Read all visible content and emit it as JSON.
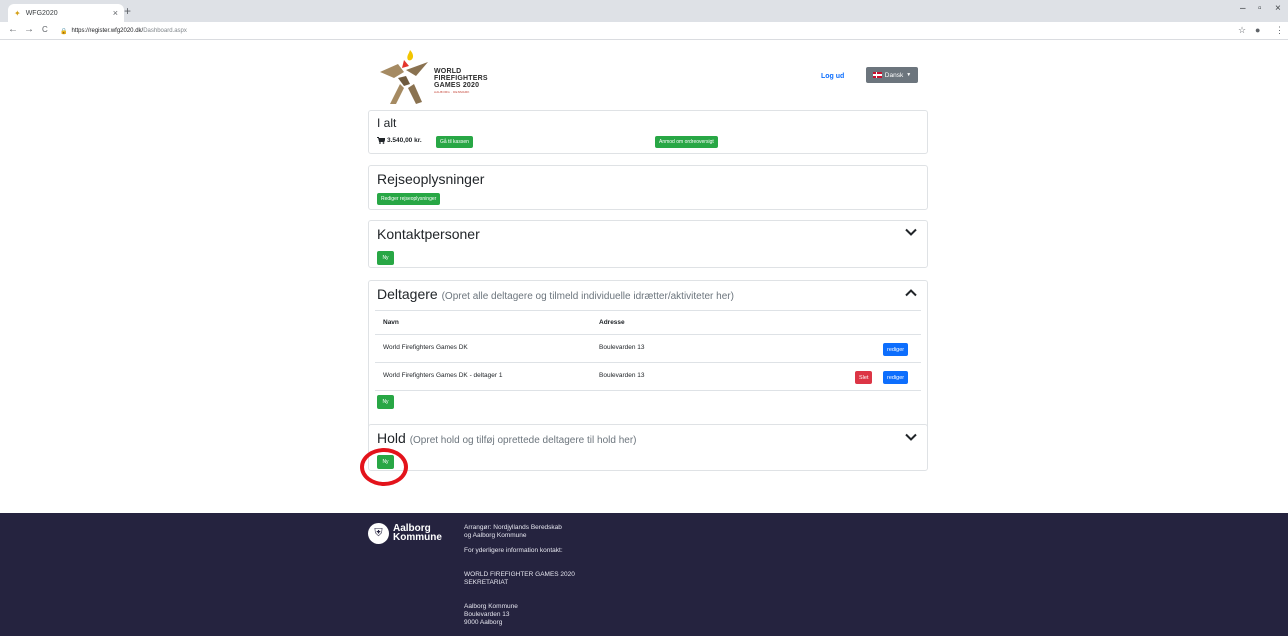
{
  "browser": {
    "tab_title": "WFG2020",
    "tab_close": "×",
    "new_tab": "+",
    "url_host": "https://register.wfg2020.dk/",
    "url_path": "Dashboard.aspx",
    "back": "←",
    "forward": "→",
    "reload": "C",
    "minimize": "–",
    "maximize": "▫",
    "close": "×",
    "bookmark": "☆",
    "menu": "⋮"
  },
  "header": {
    "logo_line1": "WORLD",
    "logo_line2": "FIREFIGHTERS",
    "logo_line3": "GAMES 2020",
    "logo_sub": "AALBORG · DENMARK",
    "logout": "Log ud",
    "language": "Dansk"
  },
  "total_card": {
    "title": "I alt",
    "amount": "3.540,00 kr.",
    "checkout_button": "Gå til kassen",
    "order_button": "Anmod om ordreoversigt"
  },
  "travel_card": {
    "title": "Rejseoplysninger",
    "edit_button": "Rediger rejseoplysninger"
  },
  "contacts_card": {
    "title": "Kontaktpersoner",
    "new_button": "Ny"
  },
  "participants_card": {
    "title": "Deltagere",
    "subtitle": "(Opret alle deltagere og tilmeld individuelle idrætter/aktiviteter her)",
    "columns": [
      "Navn",
      "Adresse"
    ],
    "rows": [
      {
        "name": "World Firefighters Games DK",
        "address": "Boulevarden 13",
        "edit": "rediger"
      },
      {
        "name": "World Firefighters Games DK - deltager 1",
        "address": "Boulevarden 13",
        "delete": "Slet",
        "edit": "rediger"
      }
    ],
    "new_button": "Ny"
  },
  "teams_card": {
    "title": "Hold",
    "subtitle": "(Opret hold og tilføj oprettede deltagere til hold her)",
    "new_button": "Ny"
  },
  "footer": {
    "brand_line1": "Aalborg",
    "brand_line2": "Kommune",
    "organizer": "Arrangør: Nordjyllands Beredskab\nog Aalborg Kommune",
    "contact": "For yderligere information kontakt:",
    "secretariat": "WORLD FIREFIGHTER GAMES 2020\nSEKRETARIAT",
    "address": "Aalborg Kommune\nBoulevarden 13\n9000 Aalborg"
  },
  "colors": {
    "green": "#28a745",
    "blue": "#0d6efd",
    "red": "#dc3545",
    "footer_bg": "#25233f",
    "highlight": "#e3131b"
  }
}
